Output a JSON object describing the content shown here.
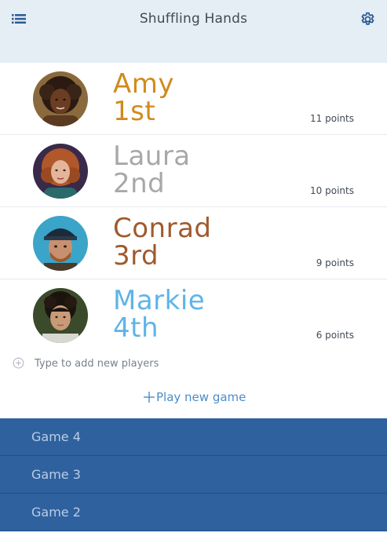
{
  "header": {
    "title": "Shuffling Hands",
    "menu_icon": "list-icon",
    "settings_icon": "gear-icon"
  },
  "players": [
    {
      "name": "Amy",
      "rank": "1st",
      "points": "11 points",
      "color": "#d08b1c",
      "avatar_icon": "avatar-amy"
    },
    {
      "name": "Laura",
      "rank": "2nd",
      "points": "10 points",
      "color": "#a8a8a8",
      "avatar_icon": "avatar-laura"
    },
    {
      "name": "Conrad",
      "rank": "3rd",
      "points": "9 points",
      "color": "#a05a2c",
      "avatar_icon": "avatar-conrad"
    },
    {
      "name": "Markie",
      "rank": "4th",
      "points": "6 points",
      "color": "#5eb4e8",
      "avatar_icon": "avatar-markie"
    }
  ],
  "add_player": {
    "placeholder": "Type to add new players",
    "icon": "plus-circle-icon"
  },
  "play_new_game": {
    "label": "Play new game",
    "icon": "plus-icon",
    "color": "#4a8ccc"
  },
  "games": [
    {
      "label": "Game 4"
    },
    {
      "label": "Game 3"
    },
    {
      "label": "Game 2"
    }
  ],
  "colors": {
    "header_bg": "#e5edf5",
    "game_row_bg": "#2f619f",
    "game_row_text": "#b9cde6"
  }
}
